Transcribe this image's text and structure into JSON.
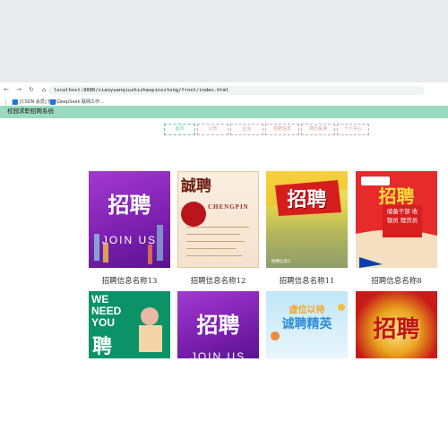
{
  "browser": {
    "url": "localhost:8080/xiaoyuanqiuzhizhaopinxitong/front/index.html",
    "bookmarks": [
      {
        "label": "[CSDN 会员] 搜索..."
      },
      {
        "label": "DeepSeek 联网工作..."
      }
    ]
  },
  "site": {
    "title": "校园求职招聘系统",
    "menu": [
      {
        "label": "首页"
      },
      {
        "label": "公告"
      },
      {
        "label": "企业"
      },
      {
        "label": "招聘信息"
      },
      {
        "label": "简历投递"
      },
      {
        "label": "个人中心"
      }
    ]
  },
  "posters": [
    {
      "caption": "招聘信息名称13",
      "headline": "招聘",
      "sub": "JOIN US"
    },
    {
      "caption": "招聘信息名称12",
      "headline": "誠聘",
      "sub": "CHENGPIN"
    },
    {
      "caption": "招聘信息名称11",
      "headline": "招聘",
      "sub": "招聘信息3"
    },
    {
      "caption": "招聘信息名称8",
      "headline": "招聘",
      "sub": "储备干部 收银员 理货员"
    },
    {
      "headline": "聘",
      "sub": "WE NEED YOU"
    },
    {
      "headline": "招聘",
      "sub": "JOIN US"
    },
    {
      "headline": "诚聘精英",
      "sub": "虚位以待"
    },
    {
      "headline": "招聘"
    }
  ],
  "colors": {
    "header_bg": "#9adbc0",
    "menu_active": "#5cc7a2",
    "menu_inactive": "#d09a9a"
  }
}
